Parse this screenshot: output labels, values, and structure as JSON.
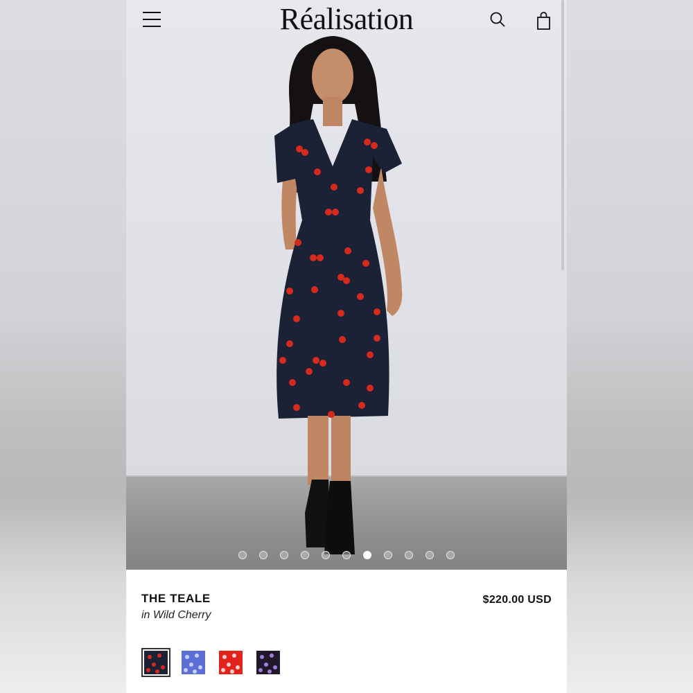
{
  "header": {
    "brand": "Réalisation",
    "menu_icon": "hamburger-icon",
    "search_icon": "search-icon",
    "bag_icon": "shopping-bag-icon"
  },
  "gallery": {
    "image_count": 11,
    "active_index": 6
  },
  "product": {
    "name": "THE TEALE",
    "variant": "in Wild Cherry",
    "price": "$220.00 USD"
  },
  "swatches": [
    {
      "name": "wild-cherry",
      "color": "#1c2236",
      "accent": "#d62a1e",
      "selected": true
    },
    {
      "name": "blue-print",
      "color": "#5b6fd6",
      "accent": "#c8d0ff",
      "selected": false
    },
    {
      "name": "red-print",
      "color": "#e0231b",
      "accent": "#ffd0d0",
      "selected": false
    },
    {
      "name": "dark-floral",
      "color": "#21182c",
      "accent": "#9d7fd6",
      "selected": false
    }
  ],
  "colors": {
    "dress": "#1c2236",
    "cherry": "#d62a1e",
    "text": "#111111"
  }
}
